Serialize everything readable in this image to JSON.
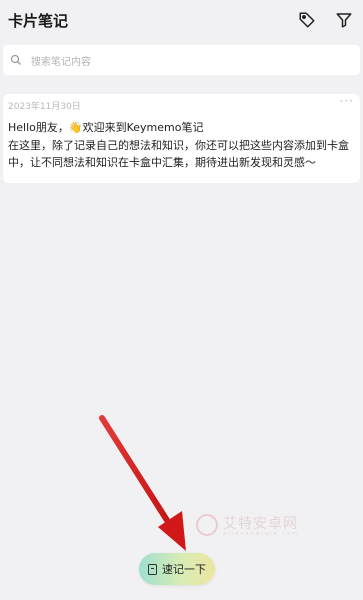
{
  "header": {
    "title": "卡片笔记",
    "tag_icon": "tag-icon",
    "filter_icon": "filter-icon"
  },
  "search": {
    "placeholder": "搜索笔记内容",
    "icon": "search-icon"
  },
  "notes": [
    {
      "date": "2023年11月30日",
      "more": "···",
      "line1_pre": "Hello朋友，",
      "emoji": "👋",
      "line1_post": "欢迎来到Keymemo笔记",
      "body": "在这里，除了记录自己的想法和知识，你还可以把这些内容添加到卡盒中，让不同想法和知识在卡盒中汇集，期待进出新发现和灵感～"
    }
  ],
  "fab": {
    "label": "速记一下",
    "icon": "note-icon"
  },
  "watermark": {
    "text": "艾特安卓网",
    "sub": "aitenandroid.com"
  },
  "colors": {
    "background": "#f1f1f3",
    "card": "#ffffff",
    "arrow": "#d42020",
    "fab_gradient_start": "#9fdfcf",
    "fab_gradient_end": "#ece6a2"
  }
}
